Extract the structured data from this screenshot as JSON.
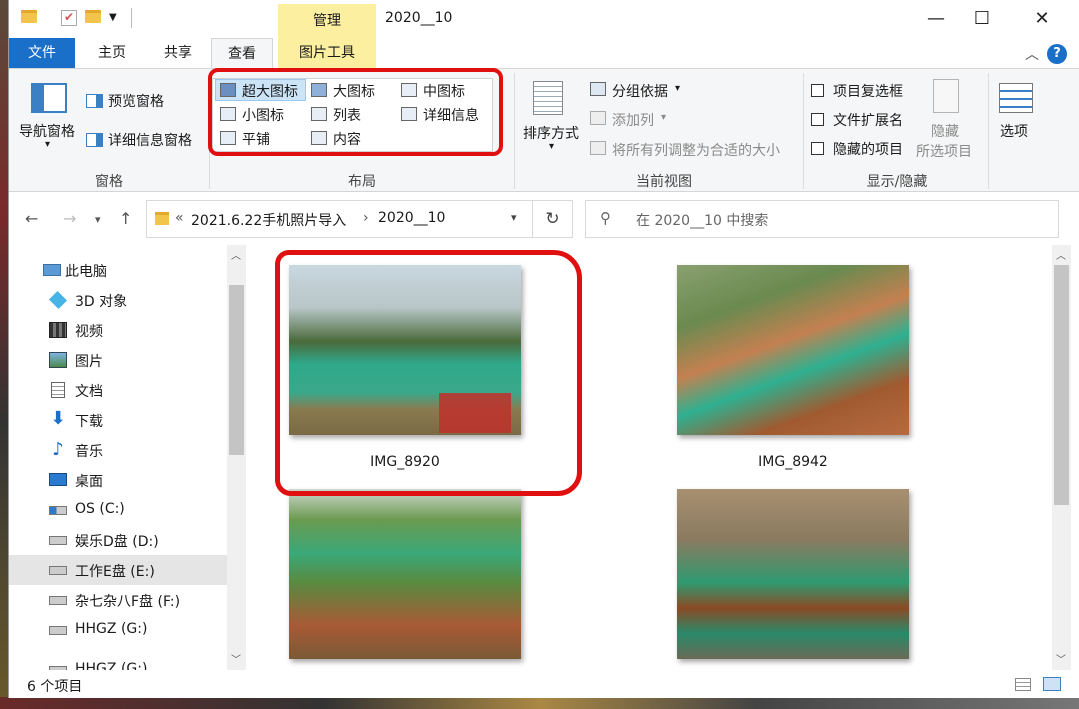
{
  "title_bar": {
    "context_tab": "管理",
    "window_title": "2020__10",
    "minimize": "—",
    "maximize": "☐",
    "close": "✕"
  },
  "tabs": [
    {
      "label": "文件"
    },
    {
      "label": "主页"
    },
    {
      "label": "共享"
    },
    {
      "label": "查看"
    },
    {
      "label": "图片工具"
    }
  ],
  "ribbon": {
    "panes": {
      "group_label": "窗格",
      "nav_pane": "导航窗格",
      "preview_pane": "预览窗格",
      "details_pane": "详细信息窗格"
    },
    "layout": {
      "group_label": "布局",
      "items": [
        "超大图标",
        "大图标",
        "中图标",
        "小图标",
        "列表",
        "详细信息",
        "平铺",
        "内容"
      ],
      "selected": "超大图标"
    },
    "current_view": {
      "group_label": "当前视图",
      "sort_by": "排序方式",
      "group_by": "分组依据",
      "add_column": "添加列",
      "fit_columns": "将所有列调整为合适的大小"
    },
    "show_hide": {
      "group_label": "显示/隐藏",
      "item_checkboxes": "项目复选框",
      "file_extensions": "文件扩展名",
      "hidden_items": "隐藏的项目",
      "hide_selected_1": "隐藏",
      "hide_selected_2": "所选项目"
    },
    "options": "选项"
  },
  "address": {
    "prefix": "«",
    "crumb1": "2021.6.22手机照片导入",
    "sep": "›",
    "crumb2": "2020__10",
    "search_placeholder": "在 2020__10 中搜索"
  },
  "nav_items": [
    {
      "label": "此电脑",
      "icon": "computer-icon"
    },
    {
      "label": "3D 对象",
      "icon": "3d-objects-icon"
    },
    {
      "label": "视频",
      "icon": "video-icon"
    },
    {
      "label": "图片",
      "icon": "pictures-icon"
    },
    {
      "label": "文档",
      "icon": "documents-icon"
    },
    {
      "label": "下载",
      "icon": "download-icon"
    },
    {
      "label": "音乐",
      "icon": "music-icon"
    },
    {
      "label": "桌面",
      "icon": "desktop-icon"
    },
    {
      "label": "OS (C:)",
      "icon": "drive-icon"
    },
    {
      "label": "娱乐D盘 (D:)",
      "icon": "drive-icon"
    },
    {
      "label": "工作E盘 (E:)",
      "icon": "drive-icon",
      "selected": true
    },
    {
      "label": "杂七杂八F盘 (F:)",
      "icon": "drive-icon"
    },
    {
      "label": "HHGZ (G:)",
      "icon": "drive-icon"
    },
    {
      "label": "HHGZ (G:)",
      "icon": "drive-icon"
    }
  ],
  "files": [
    {
      "name": "IMG_8920"
    },
    {
      "name": "IMG_8942"
    },
    {
      "name": ""
    },
    {
      "name": ""
    }
  ],
  "status": {
    "count": "6 个项目"
  },
  "colors": {
    "accent": "#1a6fc8",
    "context_tab": "#fcf0a0",
    "annotation_red": "#e01010"
  }
}
